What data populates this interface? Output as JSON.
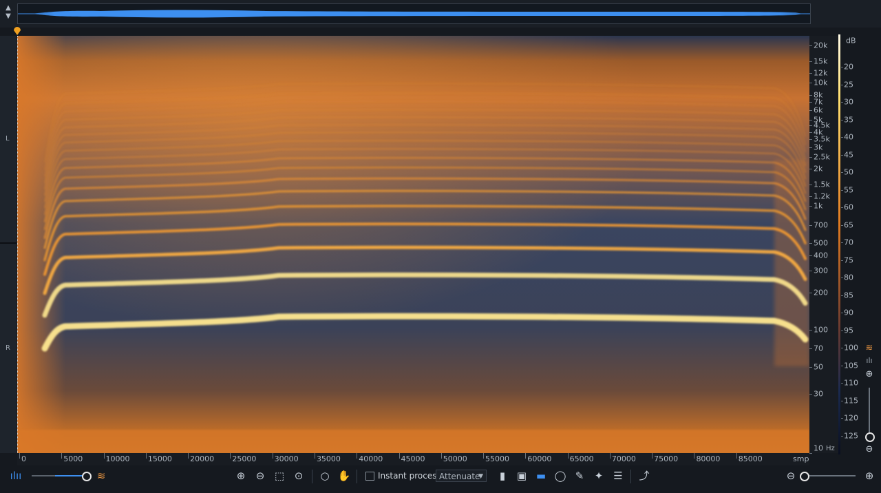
{
  "channels": {
    "left": "L",
    "right": "R"
  },
  "frequency_axis": {
    "labels": [
      "20k",
      "15k",
      "12k",
      "10k",
      "8k",
      "7k",
      "6k",
      "5k",
      "4.5k",
      "4k",
      "3.5k",
      "3k",
      "2.5k",
      "2k",
      "1.5k",
      "1.2k",
      "1k",
      "700",
      "500",
      "400",
      "300",
      "200",
      "100",
      "70",
      "50",
      "30",
      "10"
    ],
    "values": [
      20000,
      15000,
      12000,
      10000,
      8000,
      7000,
      6000,
      5000,
      4500,
      4000,
      3500,
      3000,
      2500,
      2000,
      1500,
      1200,
      1000,
      700,
      500,
      400,
      300,
      200,
      100,
      70,
      50,
      30,
      10
    ],
    "unit": "Hz"
  },
  "db_axis": {
    "unit": "dB",
    "labels": [
      "20",
      "25",
      "30",
      "35",
      "40",
      "45",
      "50",
      "55",
      "60",
      "65",
      "70",
      "75",
      "80",
      "85",
      "90",
      "95",
      "100",
      "105",
      "110",
      "115",
      "120",
      "125"
    ]
  },
  "time_axis": {
    "unit": "smp",
    "labels": [
      "0",
      "5000",
      "10000",
      "15000",
      "20000",
      "25000",
      "30000",
      "35000",
      "40000",
      "45000",
      "50000",
      "55000",
      "60000",
      "65000",
      "70000",
      "75000",
      "80000",
      "85000"
    ]
  },
  "toolbar": {
    "instant_process_label": "Instant process",
    "instant_process_checked": false,
    "mode_value": "Attenuate",
    "opacity_level_percent": 100,
    "horizontal_zoom_percent": 0,
    "icons": [
      "waveform-icon",
      "spectrogram-icon",
      "zoom-in-icon",
      "zoom-out-icon",
      "zoom-selection-icon",
      "zoom-fit-icon",
      "magnifier-icon",
      "hand-icon",
      "time-selection-icon",
      "frequency-selection-icon",
      "rectangle-selection-icon",
      "lasso-icon",
      "brush-icon",
      "magic-wand-icon",
      "harmonic-selection-icon",
      "curve-icon"
    ]
  },
  "colors": {
    "spectrogram_low": "#2a3a5a",
    "spectrogram_mid": "#d9782a",
    "spectrogram_high": "#ffe890",
    "accent": "#3d8ff0",
    "marker": "#f0a020"
  }
}
